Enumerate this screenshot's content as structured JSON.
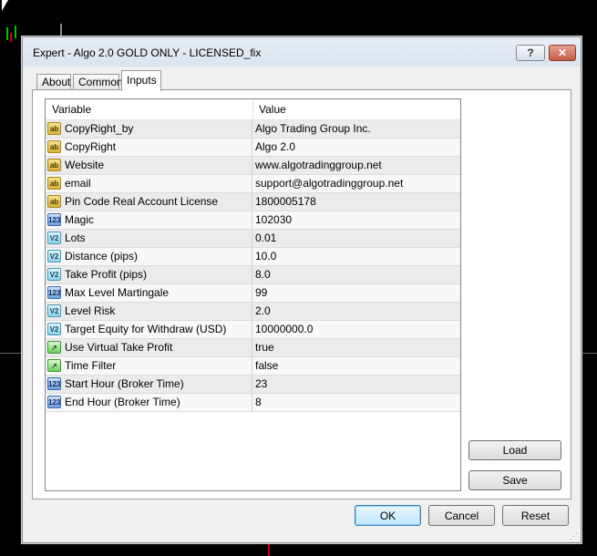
{
  "window": {
    "title": "Expert - Algo 2.0 GOLD ONLY - LICENSED_fix",
    "help_label": "?",
    "close_label": "✕"
  },
  "tabs": [
    {
      "label": "About"
    },
    {
      "label": "Common"
    },
    {
      "label": "Inputs"
    }
  ],
  "grid": {
    "headers": {
      "variable": "Variable",
      "value": "Value"
    },
    "rows": [
      {
        "type": "string",
        "icon": "ab",
        "variable": "CopyRight_by",
        "value": " Algo Trading Group Inc."
      },
      {
        "type": "string",
        "icon": "ab",
        "variable": "CopyRight",
        "value": "Algo 2.0"
      },
      {
        "type": "string",
        "icon": "ab",
        "variable": "Website",
        "value": "www.algotradinggroup.net"
      },
      {
        "type": "string",
        "icon": "ab",
        "variable": "email",
        "value": "support@algotradinggroup.net"
      },
      {
        "type": "string",
        "icon": "ab",
        "variable": "Pin Code Real Account License",
        "value": "1800005178"
      },
      {
        "type": "integer",
        "icon": "123",
        "variable": "Magic",
        "value": "102030"
      },
      {
        "type": "double",
        "icon": "v2",
        "variable": "Lots",
        "value": "0.01"
      },
      {
        "type": "double",
        "icon": "v2",
        "variable": "Distance (pips)",
        "value": "10.0"
      },
      {
        "type": "double",
        "icon": "v2",
        "variable": "Take Profit (pips)",
        "value": "8.0"
      },
      {
        "type": "integer",
        "icon": "123",
        "variable": "Max Level Martingale",
        "value": "99"
      },
      {
        "type": "double",
        "icon": "v2",
        "variable": "Level Risk",
        "value": "2.0"
      },
      {
        "type": "double",
        "icon": "v2",
        "variable": "Target Equity for Withdraw (USD)",
        "value": "10000000.0"
      },
      {
        "type": "bool",
        "icon": "bool",
        "variable": "Use Virtual Take Profit",
        "value": "true"
      },
      {
        "type": "bool",
        "icon": "bool",
        "variable": "Time Filter",
        "value": "false"
      },
      {
        "type": "integer",
        "icon": "123",
        "variable": "Start Hour (Broker Time)",
        "value": "23"
      },
      {
        "type": "integer",
        "icon": "123",
        "variable": "End Hour (Broker Time)",
        "value": "8"
      }
    ]
  },
  "buttons": {
    "load": "Load",
    "save": "Save",
    "ok": "OK",
    "cancel": "Cancel",
    "reset": "Reset"
  },
  "icon_texts": {
    "ab": "ab",
    "123": "123",
    "v2": "V2",
    "bool": "↗"
  },
  "colors": {
    "chart_background": "#000000",
    "candle_green": "#00c000",
    "candle_red": "#d00000"
  }
}
